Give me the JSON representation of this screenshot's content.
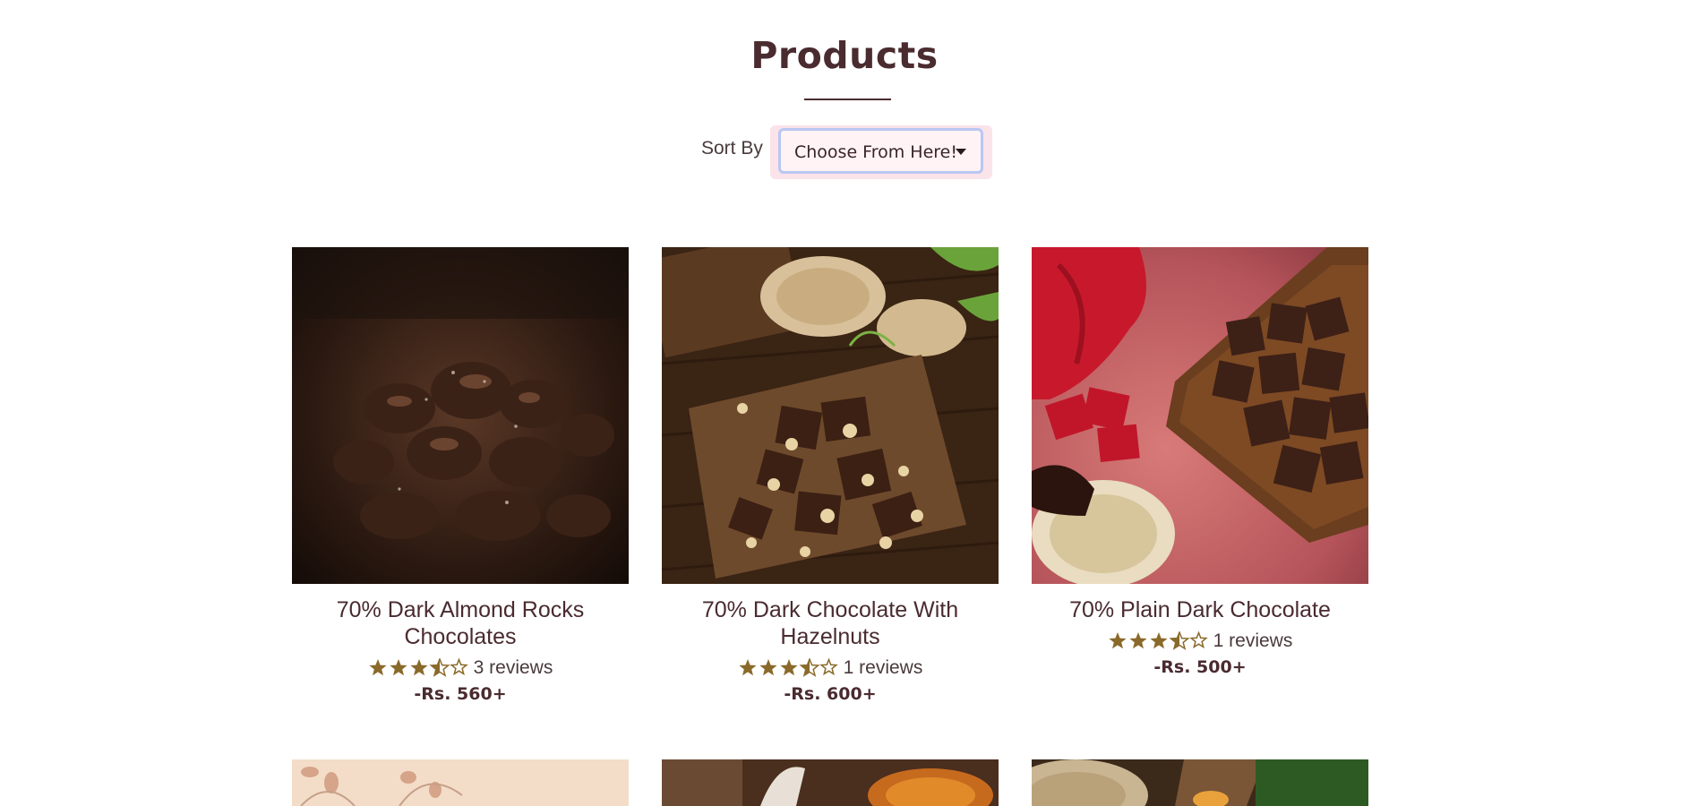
{
  "page": {
    "title": "Products"
  },
  "sort": {
    "label": "Sort By",
    "selected": "Choose From Here!"
  },
  "products": [
    {
      "name": "70% Dark Almond Rocks Chocolates",
      "rating": 3.5,
      "reviews": "3 reviews",
      "price": "-Rs. 560+",
      "image_icon": "dark-almond-rocks-image"
    },
    {
      "name": "70% Dark Chocolate With Hazelnuts",
      "rating": 3.5,
      "reviews": "1 reviews",
      "price": "-Rs. 600+",
      "image_icon": "hazelnut-chocolate-image"
    },
    {
      "name": "70% Plain Dark Chocolate",
      "rating": 3.5,
      "reviews": "1 reviews",
      "price": "-Rs. 500+",
      "image_icon": "plain-dark-chocolate-image"
    }
  ],
  "colors": {
    "text": "#4a2b2f",
    "star": "#8a6a2a",
    "select_bg": "#fff3f5",
    "select_border": "#b9c7f2"
  }
}
